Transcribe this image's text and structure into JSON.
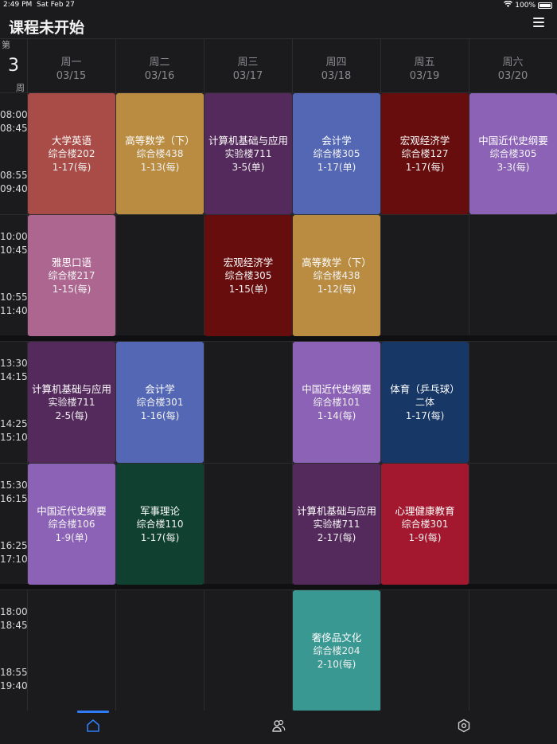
{
  "status": {
    "time": "2:49 PM",
    "date": "Sat Feb 27",
    "battery": "100%"
  },
  "header": {
    "title": "课程未开始"
  },
  "week": {
    "pre": "第",
    "num": "3",
    "post": "周"
  },
  "days": [
    {
      "name": "周一",
      "date": "03/15"
    },
    {
      "name": "周二",
      "date": "03/16"
    },
    {
      "name": "周三",
      "date": "03/17"
    },
    {
      "name": "周四",
      "date": "03/18"
    },
    {
      "name": "周五",
      "date": "03/19"
    },
    {
      "name": "周六",
      "date": "03/20"
    }
  ],
  "slots": [
    {
      "a": "08:00",
      "b": "08:45",
      "c": "08:55",
      "d": "09:40"
    },
    {
      "a": "10:00",
      "b": "10:45",
      "c": "10:55",
      "d": "11:40"
    },
    {
      "a": "13:30",
      "b": "14:15",
      "c": "14:25",
      "d": "15:10"
    },
    {
      "a": "15:30",
      "b": "16:15",
      "c": "16:25",
      "d": "17:10"
    },
    {
      "a": "18:00",
      "b": "18:45",
      "c": "18:55",
      "d": "19:40"
    }
  ],
  "courses": [
    {
      "day": 0,
      "slot": 0,
      "name": "大学英语",
      "room": "综合楼202",
      "weeks": "1-17(每)",
      "color": "#a94b46"
    },
    {
      "day": 1,
      "slot": 0,
      "name": "高等数学（下）",
      "room": "综合楼438",
      "weeks": "1-13(每)",
      "color": "#b98c41"
    },
    {
      "day": 2,
      "slot": 0,
      "name": "计算机基础与应用",
      "room": "实验楼711",
      "weeks": "3-5(单)",
      "color": "#542a5c"
    },
    {
      "day": 3,
      "slot": 0,
      "name": "会计学",
      "room": "综合楼305",
      "weeks": "1-17(单)",
      "color": "#5367b4"
    },
    {
      "day": 4,
      "slot": 0,
      "name": "宏观经济学",
      "room": "综合楼127",
      "weeks": "1-17(每)",
      "color": "#680d0d"
    },
    {
      "day": 5,
      "slot": 0,
      "name": "中国近代史纲要",
      "room": "综合楼305",
      "weeks": "3-3(每)",
      "color": "#8b62b6"
    },
    {
      "day": 0,
      "slot": 1,
      "name": "雅思口语",
      "room": "综合楼217",
      "weeks": "1-15(每)",
      "color": "#ad6690"
    },
    {
      "day": 2,
      "slot": 1,
      "name": "宏观经济学",
      "room": "综合楼305",
      "weeks": "1-15(单)",
      "color": "#680d0d"
    },
    {
      "day": 3,
      "slot": 1,
      "name": "高等数学（下）",
      "room": "综合楼438",
      "weeks": "1-12(每)",
      "color": "#b98c41"
    },
    {
      "day": 0,
      "slot": 2,
      "name": "计算机基础与应用",
      "room": "实验楼711",
      "weeks": "2-5(每)",
      "color": "#542a5c"
    },
    {
      "day": 1,
      "slot": 2,
      "name": "会计学",
      "room": "综合楼301",
      "weeks": "1-16(每)",
      "color": "#5367b4"
    },
    {
      "day": 3,
      "slot": 2,
      "name": "中国近代史纲要",
      "room": "综合楼101",
      "weeks": "1-14(每)",
      "color": "#8b62b6"
    },
    {
      "day": 4,
      "slot": 2,
      "name": "体育（乒乓球）",
      "room": "二体",
      "weeks": "1-17(每)",
      "color": "#173766"
    },
    {
      "day": 0,
      "slot": 3,
      "name": "中国近代史纲要",
      "room": "综合楼106",
      "weeks": "1-9(单)",
      "color": "#8b62b6"
    },
    {
      "day": 1,
      "slot": 3,
      "name": "军事理论",
      "room": "综合楼110",
      "weeks": "1-17(每)",
      "color": "#10402f"
    },
    {
      "day": 3,
      "slot": 3,
      "name": "计算机基础与应用",
      "room": "实验楼711",
      "weeks": "2-17(每)",
      "color": "#542a5c"
    },
    {
      "day": 4,
      "slot": 3,
      "name": "心理健康教育",
      "room": "综合楼301",
      "weeks": "1-9(每)",
      "color": "#a3182e"
    },
    {
      "day": 3,
      "slot": 4,
      "name": "奢侈品文化",
      "room": "综合楼204",
      "weeks": "2-10(每)",
      "color": "#3a9892"
    }
  ],
  "tabs": [
    {
      "icon": "home-icon"
    },
    {
      "icon": "friends-icon"
    },
    {
      "icon": "settings-icon"
    }
  ],
  "accent": "#2f7cf6"
}
